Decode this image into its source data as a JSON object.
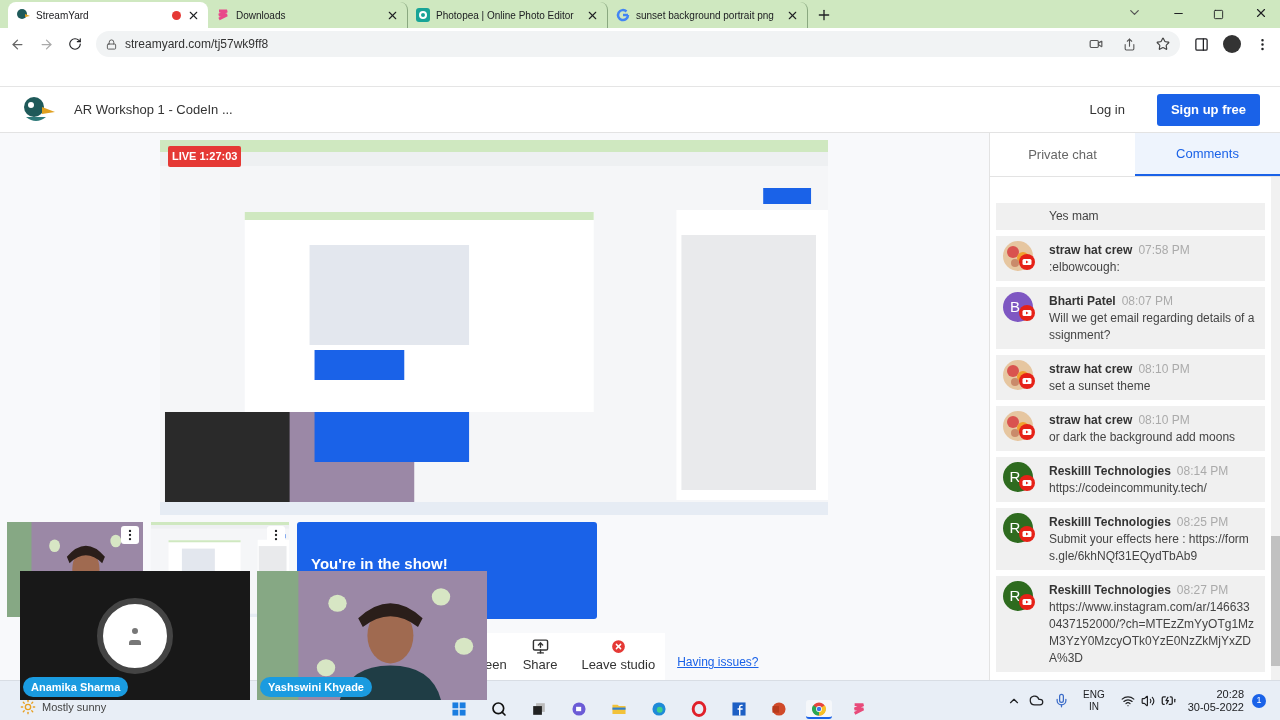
{
  "browser": {
    "tabs": [
      {
        "title": "StreamYard",
        "selected": true,
        "recording": true
      },
      {
        "title": "Downloads",
        "selected": false,
        "recording": false
      },
      {
        "title": "Photopea | Online Photo Editor",
        "selected": false,
        "recording": false
      },
      {
        "title": "sunset background portrait png",
        "selected": false,
        "recording": false
      }
    ],
    "url": "streamyard.com/tj57wk9ff8"
  },
  "header": {
    "title": "AR Workshop 1 - CodeIn ...",
    "login": "Log in",
    "signup": "Sign up free"
  },
  "stage": {
    "live_badge": "LIVE 1:27:03",
    "banner": "You're in the show!",
    "toolbar": [
      {
        "label": "een",
        "kind": "cut"
      },
      {
        "label": "Share",
        "kind": "share"
      },
      {
        "label": "Leave studio",
        "kind": "leave"
      }
    ],
    "help_link": "Having issues?"
  },
  "cameras": [
    {
      "name": "Anamika Sharma",
      "kind": "off"
    },
    {
      "name": "Yashswini Khyade",
      "kind": "video"
    }
  ],
  "chat": {
    "tabs": [
      {
        "label": "Private chat",
        "selected": false
      },
      {
        "label": "Comments",
        "selected": true
      }
    ],
    "messages": [
      {
        "kind": "continuation",
        "text": "Yes mam"
      },
      {
        "author": "straw hat crew",
        "time": "07:58 PM",
        "text": ":elbowcough:"
      },
      {
        "kind": "lettered",
        "author": "Bharti Patel",
        "time": "08:07 PM",
        "text": "Will we get email regarding details of assignment?",
        "letter": "B",
        "color": "#7e57c2"
      },
      {
        "author": "straw hat crew",
        "time": "08:10 PM",
        "text": "set a sunset theme"
      },
      {
        "author": "straw hat crew",
        "time": "08:10 PM",
        "text": "or dark the background add moons"
      },
      {
        "kind": "lettered",
        "author": "Reskilll Technologies",
        "time": "08:14 PM",
        "text": "https://codeincommunity.tech/",
        "letter": "R",
        "color": "#2e6b1f"
      },
      {
        "kind": "lettered",
        "author": "Reskilll Technologies",
        "time": "08:25 PM",
        "text": "Submit your effects here : https://forms.gle/6khNQf31EQydTbAb9",
        "letter": "R",
        "color": "#2e6b1f"
      },
      {
        "kind": "lettered",
        "author": "Reskilll Technologies",
        "time": "08:27 PM",
        "text": "https://www.instagram.com/ar/1466330437152000/?ch=MTEzZmYyOTg1MzM3YzY0MzcyOTk0YzE0NzZkMjYxZDA%3D",
        "letter": "R",
        "color": "#2e6b1f"
      }
    ]
  },
  "taskbar": {
    "weather": "Mostly sunny",
    "apps": [
      {
        "kind": "windows",
        "active": false
      },
      {
        "kind": "search",
        "active": false
      },
      {
        "kind": "taskview",
        "active": false
      },
      {
        "kind": "chat",
        "active": false
      },
      {
        "kind": "explorer",
        "active": false
      },
      {
        "kind": "edge",
        "active": false
      },
      {
        "kind": "opera",
        "active": false
      },
      {
        "kind": "facebook",
        "active": false
      },
      {
        "kind": "powerpoint",
        "active": false
      },
      {
        "kind": "chrome",
        "active": true
      },
      {
        "kind": "streamyard",
        "active": false
      }
    ],
    "lang": "ENG",
    "region": "IN",
    "time": "20:28",
    "date": "30-05-2022",
    "notifications": "1"
  }
}
